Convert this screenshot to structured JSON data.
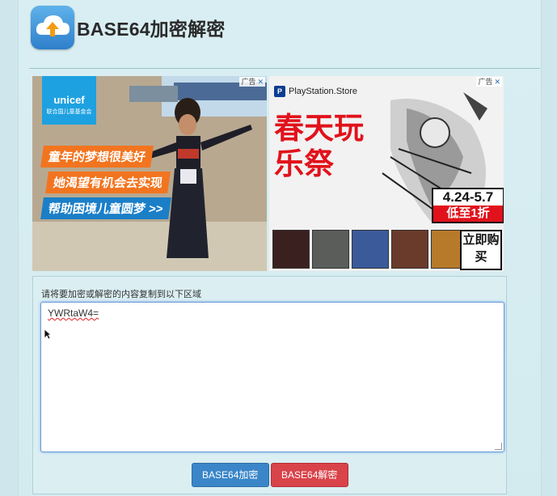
{
  "app": {
    "title": "BASE64加密解密",
    "logo_icon": "cloud-upload-icon"
  },
  "ads": {
    "left": {
      "tag": "广告",
      "close": "✕",
      "brand": "unicef",
      "brand_sub": "联合国儿童基金会",
      "lines": [
        "童年的梦想很美好",
        "她渴望有机会去实现",
        "帮助困境儿童圆梦 >>"
      ]
    },
    "right": {
      "tag": "广告",
      "close": "✕",
      "brand": "PlayStation.Store",
      "headline": "春天玩乐祭",
      "date_range": "4.24-5.7",
      "discount": "低至1折",
      "cta": "立即购买"
    }
  },
  "form": {
    "label": "请将要加密或解密的内容复制到以下区域",
    "input_value": "YWRtaW4="
  },
  "buttons": {
    "encode": "BASE64加密",
    "decode": "BASE64解密"
  },
  "colors": {
    "encode": "#3a86c8",
    "decode": "#d9434a",
    "spring_red": "#e1121b",
    "unicef_blue": "#1ea1e0"
  }
}
